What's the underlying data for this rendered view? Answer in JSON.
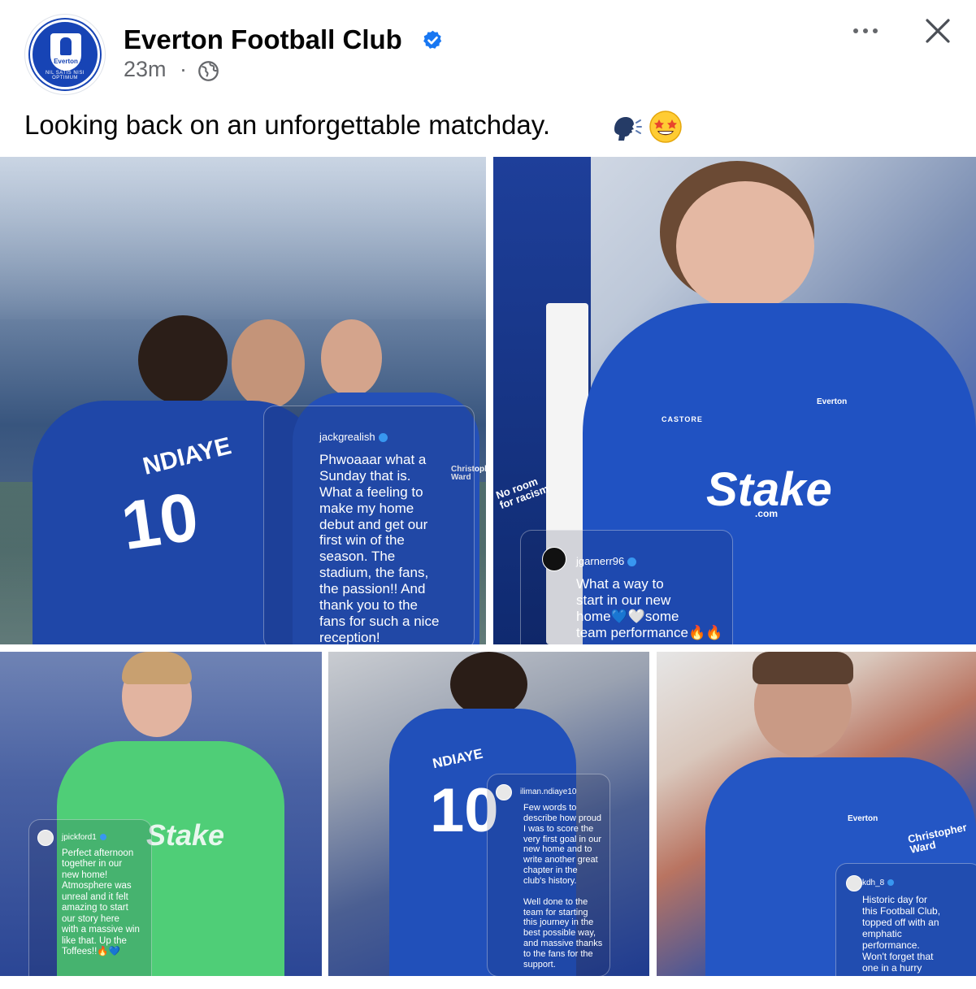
{
  "post": {
    "page_name": "Everton Football Club",
    "timestamp": "23m",
    "separator": "·",
    "caption": "Looking back on an unforgettable matchday.",
    "avatar_label": "Everton",
    "avatar_ring_text": "NIL SATIS NISI OPTIMUM",
    "icons": {
      "verified": "verified-badge-icon",
      "audience": "globe-icon",
      "more": "more-options-icon",
      "close": "close-icon",
      "emoji_1": "speaking-head-emoji",
      "emoji_2": "star-struck-emoji"
    },
    "colors": {
      "brand_blue": "#1744b5",
      "verified_blue": "#1877f2",
      "secondary_text": "#65676b"
    }
  },
  "photos": [
    {
      "jersey_name": "NDIAYE",
      "jersey_number": "10",
      "sponsor_text": "Christopher Ward",
      "story": {
        "user": "jackgrealish",
        "text": "Phwoaaar what a\nSunday that is.\nWhat a feeling to\nmake my home\ndebut and get our\nfirst win of the\nseason. The\nstadium, the fans,\nthe passion!! And\nthank you to the\nfans for such a nice\nreception!\nIncredible💙"
      }
    },
    {
      "flag_text": "No room for racism",
      "kit_brand": "CASTORE",
      "sponsor_text": "Stake",
      "sponsor_sub": ".com",
      "badge_text": "Everton",
      "story": {
        "user": "jgarnerr96",
        "text": "What a way to\nstart in our new\nhome💙🤍some\nteam performance🔥🔥"
      }
    },
    {
      "sponsor_text": "Stake",
      "story": {
        "user": "jpickford1",
        "text": "Perfect afternoon\ntogether in our\nnew home!\nAtmosphere was\nunreal and it felt\namazing to start\nour story here\nwith a massive win\nlike that. Up the\nToffees!!🔥💙"
      }
    },
    {
      "jersey_name": "NDIAYE",
      "jersey_number": "10",
      "story": {
        "user": "iliman.ndiaye10",
        "text": "Few words to\ndescribe how proud\nI was to score the\nvery first goal in our\nnew home and to\nwrite another great\nchapter in the\nclub's history.\n\nWell done to the\nteam for starting\nthis journey in the\nbest possible way,\nand massive thanks\nto the fans for the\nsupport."
      }
    },
    {
      "sponsor_text": "Christopher Ward",
      "badge_text": "Everton",
      "story": {
        "user": "kdh_8",
        "text": "Historic day for\nthis Football Club,\ntopped off with an\nemphatic\nperformance.\nWon't forget that\none in a hurry"
      }
    }
  ]
}
